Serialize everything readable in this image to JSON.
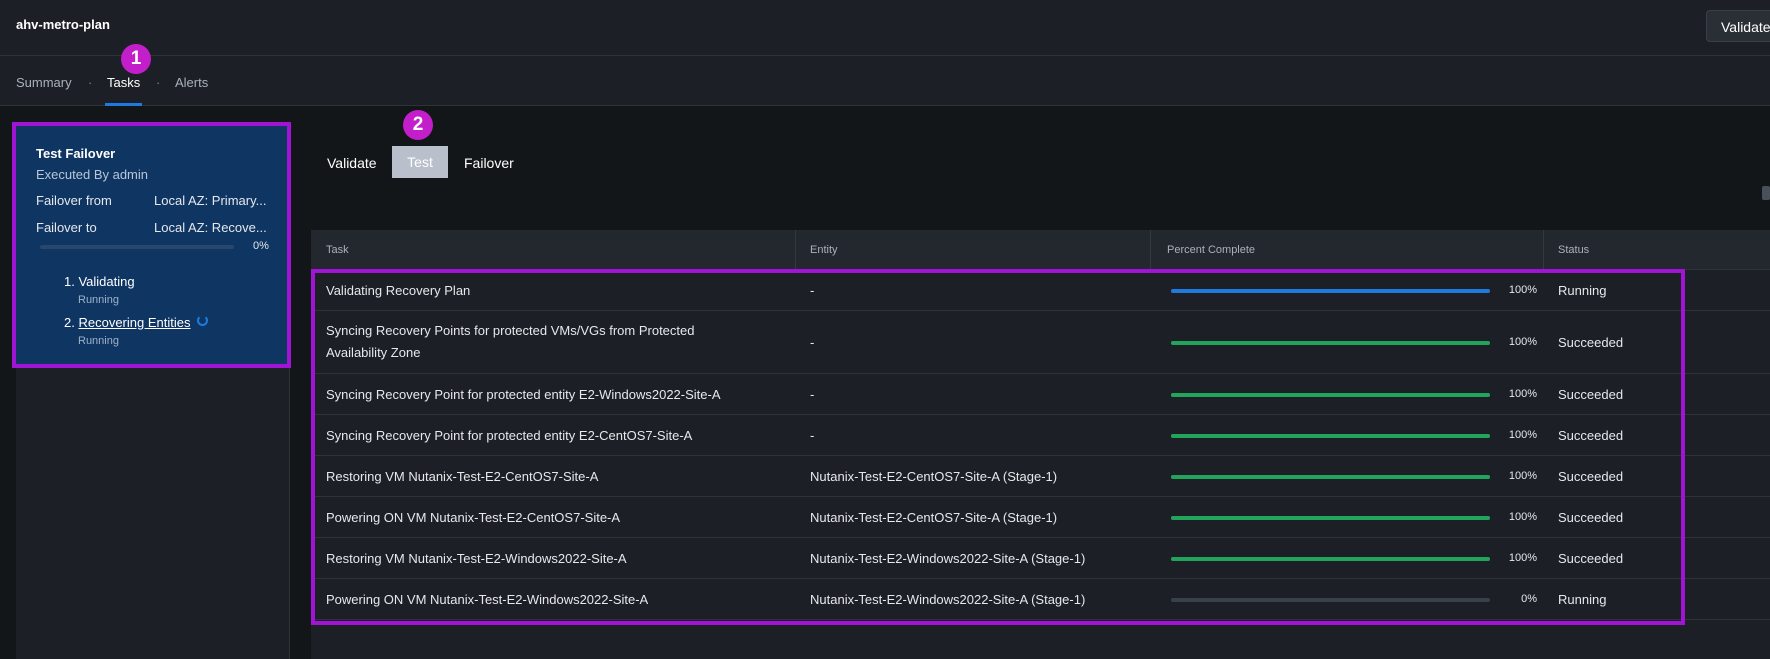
{
  "header": {
    "title": "ahv-metro-plan",
    "validate_button": "Validate"
  },
  "tabs": [
    {
      "label": "Summary",
      "active": false
    },
    {
      "label": "Tasks",
      "active": true
    },
    {
      "label": "Alerts",
      "active": false
    }
  ],
  "tab_separator": "·",
  "annotations": {
    "badge_1": "1",
    "badge_2": "2",
    "highlight_color": "#a114d6"
  },
  "job": {
    "title": "Test Failover",
    "executed_by": "Executed By admin",
    "failover_from_label": "Failover from",
    "failover_from_value": "Local AZ: Primary...",
    "failover_to_label": "Failover to",
    "failover_to_value": "Local AZ: Recove...",
    "progress": 0,
    "progress_text": "0%",
    "steps": [
      {
        "label": "1. Validating",
        "status": "Running"
      },
      {
        "label": "Recovering Entities",
        "number": "2.",
        "status": "Running"
      }
    ]
  },
  "subtabs": [
    {
      "label": "Validate",
      "active": false
    },
    {
      "label": "Test",
      "active": true
    },
    {
      "label": "Failover",
      "active": false
    }
  ],
  "table": {
    "columns": [
      "Task",
      "Entity",
      "Percent Complete",
      "Status"
    ],
    "rows": [
      {
        "task": "Validating Recovery Plan",
        "entity": "-",
        "percent": 100,
        "percent_text": "100%",
        "status": "Running",
        "bar_color": "#1f7ae0"
      },
      {
        "task": "Syncing Recovery Points for protected VMs/VGs from Protected Availability Zone",
        "entity": "-",
        "percent": 100,
        "percent_text": "100%",
        "status": "Succeeded",
        "bar_color": "#22a55b"
      },
      {
        "task": "Syncing Recovery Point for protected entity E2-Windows2022-Site-A",
        "entity": "-",
        "percent": 100,
        "percent_text": "100%",
        "status": "Succeeded",
        "bar_color": "#22a55b"
      },
      {
        "task": "Syncing Recovery Point for protected entity E2-CentOS7-Site-A",
        "entity": "-",
        "percent": 100,
        "percent_text": "100%",
        "status": "Succeeded",
        "bar_color": "#22a55b"
      },
      {
        "task": "Restoring VM Nutanix-Test-E2-CentOS7-Site-A",
        "entity": "Nutanix-Test-E2-CentOS7-Site-A (Stage-1)",
        "percent": 100,
        "percent_text": "100%",
        "status": "Succeeded",
        "bar_color": "#22a55b"
      },
      {
        "task": "Powering ON VM Nutanix-Test-E2-CentOS7-Site-A",
        "entity": "Nutanix-Test-E2-CentOS7-Site-A (Stage-1)",
        "percent": 100,
        "percent_text": "100%",
        "status": "Succeeded",
        "bar_color": "#22a55b"
      },
      {
        "task": "Restoring VM Nutanix-Test-E2-Windows2022-Site-A",
        "entity": "Nutanix-Test-E2-Windows2022-Site-A (Stage-1)",
        "percent": 100,
        "percent_text": "100%",
        "status": "Succeeded",
        "bar_color": "#22a55b"
      },
      {
        "task": "Powering ON VM Nutanix-Test-E2-Windows2022-Site-A",
        "entity": "Nutanix-Test-E2-Windows2022-Site-A (Stage-1)",
        "percent": 0,
        "percent_text": "0%",
        "status": "Running",
        "bar_color": "#22a55b"
      }
    ]
  }
}
